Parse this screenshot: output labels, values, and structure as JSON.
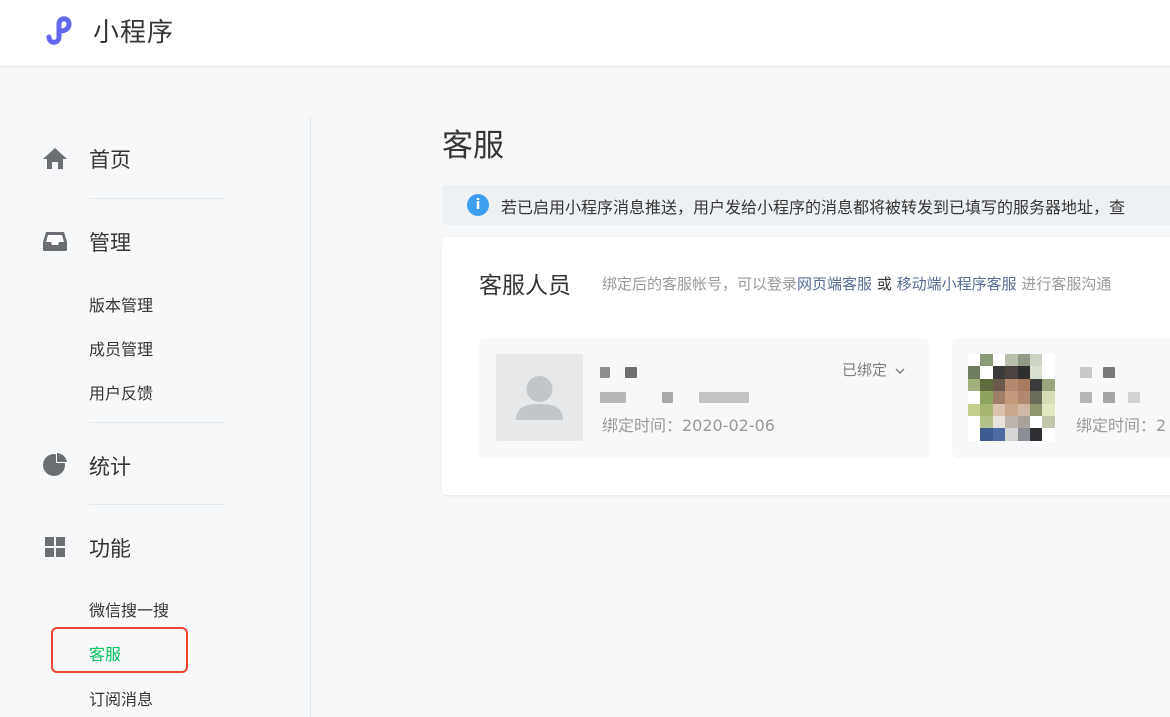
{
  "app": {
    "name": "小程序"
  },
  "sidebar": {
    "sections": [
      {
        "label": "首页",
        "icon": "home-icon"
      },
      {
        "label": "管理",
        "icon": "inbox-icon",
        "items": [
          "版本管理",
          "成员管理",
          "用户反馈"
        ]
      },
      {
        "label": "统计",
        "icon": "pie-chart-icon"
      },
      {
        "label": "功能",
        "icon": "grid-icon",
        "items": [
          "微信搜一搜",
          "客服",
          "订阅消息"
        ]
      }
    ],
    "active_item": "客服"
  },
  "main": {
    "title": "客服",
    "notice": "若已启用小程序消息推送，用户发给小程序的消息都将被转发到已填写的服务器地址，查",
    "panel": {
      "title": "客服人员",
      "desc_prefix": "绑定后的客服帐号，可以登录",
      "link_web": "网页端客服",
      "desc_or": "或",
      "link_mobile": "移动端小程序客服",
      "desc_suffix": "进行客服沟通"
    },
    "agents": [
      {
        "status": "已绑定",
        "bind_time": "绑定时间：2020-02-06"
      },
      {
        "bind_time": "绑定时间：2"
      }
    ]
  },
  "colors": {
    "accent_green": "#07c160",
    "link_blue": "#576b95",
    "info_blue": "#3e9ff0",
    "highlight_red": "#e8472f",
    "brand_purple": "#6467f0"
  }
}
